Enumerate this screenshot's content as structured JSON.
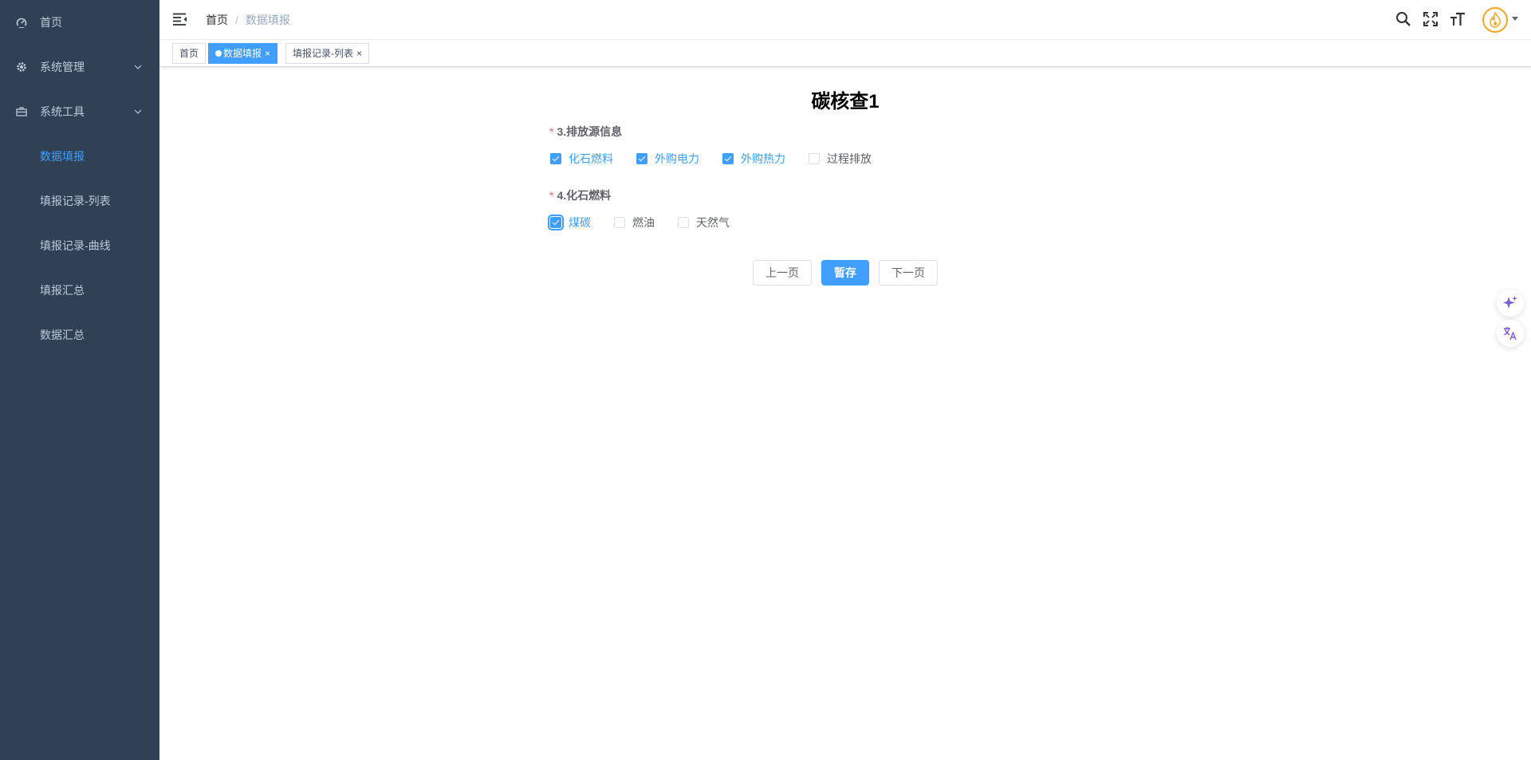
{
  "sidebar": {
    "items": [
      {
        "label": "首页"
      },
      {
        "label": "系统管理"
      },
      {
        "label": "系统工具"
      }
    ],
    "subitems": [
      {
        "label": "数据填报"
      },
      {
        "label": "填报记录-列表"
      },
      {
        "label": "填报记录-曲线"
      },
      {
        "label": "填报汇总"
      },
      {
        "label": "数据汇总"
      }
    ]
  },
  "navbar": {
    "breadcrumb": {
      "home": "首页",
      "separator": "/",
      "current": "数据填报"
    }
  },
  "tags": [
    {
      "label": "首页"
    },
    {
      "label": "数据填报",
      "close": "×"
    },
    {
      "label": "填报记录-列表",
      "close": "×"
    }
  ],
  "form": {
    "title": "碳核查1",
    "q3": {
      "required_mark": "*",
      "label": "3.排放源信息",
      "options": [
        {
          "label": "化石燃料",
          "checked": true
        },
        {
          "label": "外购电力",
          "checked": true
        },
        {
          "label": "外购热力",
          "checked": true
        },
        {
          "label": "过程排放",
          "checked": false
        }
      ]
    },
    "q4": {
      "required_mark": "*",
      "label": "4.化石燃料",
      "options": [
        {
          "label": "煤碳",
          "checked": true
        },
        {
          "label": "燃油",
          "checked": false
        },
        {
          "label": "天然气",
          "checked": false
        }
      ]
    },
    "buttons": {
      "prev": "上一页",
      "save": "暂存",
      "next": "下一页"
    }
  },
  "colors": {
    "sidebar_bg": "#304156",
    "accent": "#409eff",
    "required": "#f56c6c",
    "avatar_ring": "#f5a623"
  },
  "icons": {
    "nav": [
      "search-icon",
      "fullscreen-icon",
      "font-size-icon"
    ],
    "floating": [
      "sparkle-icon",
      "translate-icon"
    ]
  }
}
